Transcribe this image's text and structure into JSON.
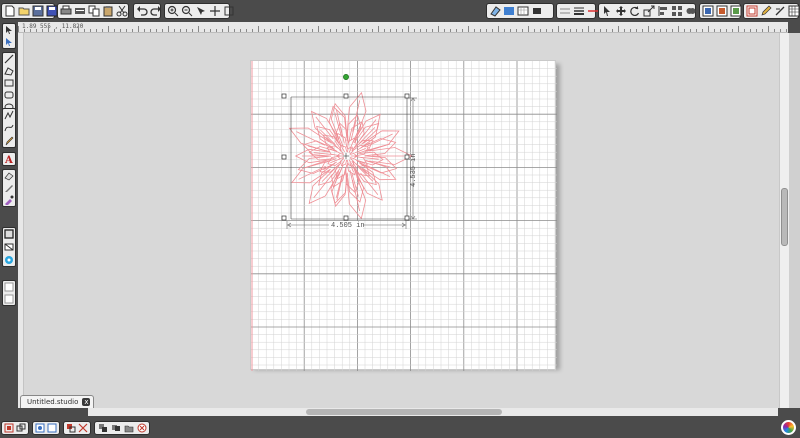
{
  "document": {
    "tab_label": "Untitled.studio",
    "close_glyph": "x"
  },
  "ruler": {
    "coordinate_readout": "1.89 555 , 11.820"
  },
  "selection": {
    "width_label": "4.505 in",
    "height_label": "4.535 in"
  },
  "toolbar_top": {
    "groups": [
      {
        "name": "file-group",
        "icons": [
          "new-icon",
          "open-icon",
          "save-icon",
          "save-as-icon"
        ]
      },
      {
        "name": "clipboard-group",
        "icons": [
          "print-icon",
          "send-icon",
          "copy-icon",
          "paste-icon",
          "cut-icon"
        ]
      },
      {
        "name": "history-group",
        "icons": [
          "undo-icon",
          "redo-icon"
        ]
      },
      {
        "name": "zoom-group",
        "icons": [
          "zoom-in-icon",
          "zoom-out-icon",
          "zoom-select-icon",
          "pan-icon",
          "fit-page-icon"
        ]
      },
      {
        "name": "design-group",
        "icons": [
          "eraser-icon",
          "grid-icon",
          "page-icon",
          "fill-icon"
        ]
      },
      {
        "name": "line-group",
        "icons": [
          "line-style-icon",
          "line-weight-icon",
          "line-end-icon"
        ]
      },
      {
        "name": "transform-group",
        "icons": [
          "pointer-icon",
          "move-icon",
          "rotate-icon",
          "scale-icon",
          "align-icon",
          "replicate-icon",
          "weld-icon",
          "arrange-icon",
          "offset-icon"
        ]
      },
      {
        "name": "panels-group",
        "icons": [
          "library-icon",
          "store-icon",
          "trace-icon"
        ]
      },
      {
        "name": "settings-group",
        "icons": [
          "layers-icon",
          "pen-icon",
          "sketch-icon",
          "grid-panel-icon"
        ]
      }
    ]
  },
  "toolbar_left": {
    "groups": [
      {
        "name": "select-group",
        "icons": [
          "select-icon",
          "edit-points-icon"
        ]
      },
      {
        "name": "draw-group",
        "icons": [
          "line-tool-icon",
          "polygon-icon",
          "rectangle-icon",
          "rounded-rect-icon",
          "ellipse-icon"
        ]
      },
      {
        "name": "freehand-group",
        "icons": [
          "polyline-icon",
          "curve-icon",
          "freehand-icon"
        ]
      },
      {
        "name": "text-group",
        "icons": [
          "text-icon"
        ]
      },
      {
        "name": "knife-group",
        "icons": [
          "eraser-tool-icon",
          "knife-icon",
          "eyedropper-icon"
        ]
      },
      {
        "name": "media-group",
        "icons": [
          "page-view-icon",
          "cut-view-icon",
          "color-picker-icon"
        ]
      },
      {
        "name": "page-group",
        "icons": [
          "page-add-icon",
          "page-remove-icon"
        ]
      }
    ]
  },
  "toolbar_bottom": {
    "groups": [
      {
        "name": "group-ops",
        "icons": [
          "group-icon",
          "ungroup-icon"
        ]
      },
      {
        "name": "compound-ops",
        "icons": [
          "make-compound-icon",
          "release-compound-icon"
        ]
      },
      {
        "name": "arrange-ops",
        "icons": [
          "bring-forward-icon",
          "send-backward-icon"
        ]
      },
      {
        "name": "misc-ops",
        "icons": [
          "duplicate-icon",
          "delete-icon"
        ]
      }
    ]
  },
  "colors": {
    "app_bg": "#4b4b4b",
    "canvas_bg": "#d8d8d8",
    "mat_bg": "#ffffff",
    "grid_minor": "#d3d3d3",
    "grid_major": "#8c8c8c",
    "design_stroke": "#ef8f96",
    "rotate_handle": "#33a532",
    "margin_line": "#ef9aa0"
  }
}
